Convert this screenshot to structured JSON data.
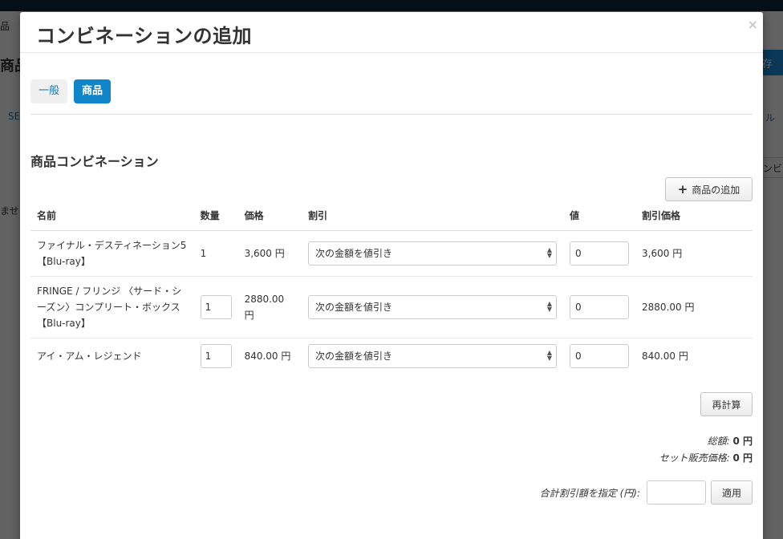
{
  "background": {
    "frag_nav": "品",
    "frag_title": "商品",
    "frag_se": "SE",
    "frag_ru": "ル",
    "frag_mase": "ませ",
    "frag_btn_blue": "存",
    "frag_btn_grey": "ンビ"
  },
  "modal": {
    "title": "コンビネーションの追加",
    "close": "×",
    "tabs": [
      {
        "label": "一般",
        "active": false
      },
      {
        "label": "商品",
        "active": true
      }
    ],
    "section_title": "商品コンビネーション",
    "add_product_label": "商品の追加",
    "table": {
      "headers": [
        "名前",
        "数量",
        "価格",
        "割引",
        "値",
        "割引価格"
      ],
      "rows": [
        {
          "name": "ファイナル・デスティネーション5 【Blu-ray】",
          "qty": "1",
          "qty_editable": false,
          "price": "3,600 円",
          "discount": "次の金額を値引き",
          "value": "0",
          "discounted_price": "3,600 円"
        },
        {
          "name": "FRINGE / フリンジ 〈サード・シーズン〉コンプリート・ボックス 【Blu-ray】",
          "qty": "1",
          "qty_editable": true,
          "price": "2880.00 円",
          "discount": "次の金額を値引き",
          "value": "0",
          "discounted_price": "2880.00 円"
        },
        {
          "name": "アイ・アム・レジェンド",
          "qty": "1",
          "qty_editable": true,
          "price": "840.00 円",
          "discount": "次の金額を値引き",
          "value": "0",
          "discounted_price": "840.00 円"
        }
      ]
    },
    "recalc_label": "再計算",
    "total_label": "総額:",
    "total_value": "0 円",
    "set_price_label": "セット販売価格:",
    "set_price_value": "0 円",
    "discount_total_label": "合計割引額を指定 (円):",
    "discount_total_value": "",
    "apply_label": "適用"
  },
  "colors": {
    "primary": "#0e86c9",
    "link": "#1a78b4",
    "topbar": "#0f2a38"
  }
}
